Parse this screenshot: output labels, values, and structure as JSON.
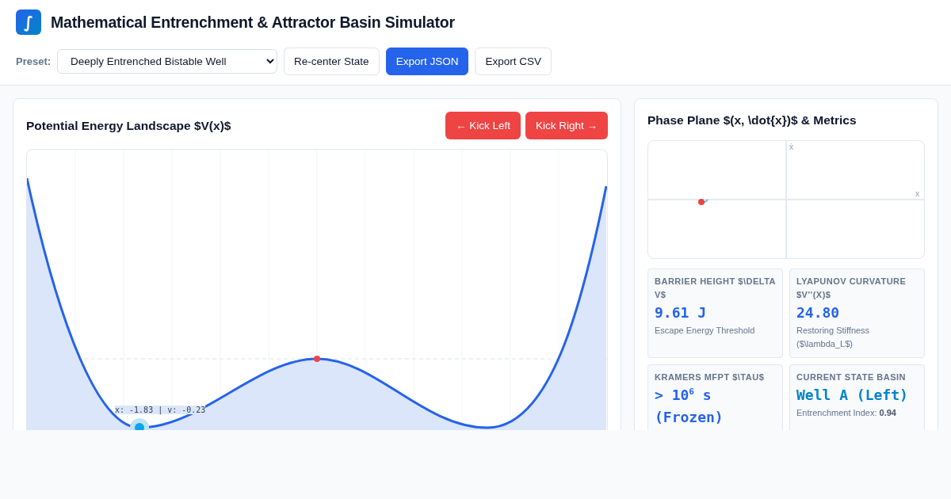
{
  "header": {
    "logo": "∫",
    "title": "Mathematical Entrenchment & Attractor Basin Simulator"
  },
  "toolbar": {
    "preset_label": "Preset:",
    "preset_value": "Deeply Entrenched Bistable Well",
    "buttons": [
      {
        "label": "Re-center State",
        "kind": "plain"
      },
      {
        "label": "Export JSON",
        "kind": "primary"
      },
      {
        "label": "Export CSV",
        "kind": "plain"
      }
    ]
  },
  "potential_panel": {
    "title": "Potential Energy Landscape $V(x)$",
    "buttons": [
      {
        "label": "Kick Left",
        "arrow": "←",
        "kind": "left"
      },
      {
        "label": "Kick Right",
        "arrow": "→",
        "kind": "right"
      }
    ],
    "readout": "x: -1.83 | v: -0.23"
  },
  "phase_panel": {
    "title": "Phase Plane $(x, \\dot{x})$ & Metrics",
    "y_axis_label": "ẋ",
    "x_axis_label": "x",
    "metrics": [
      {
        "label": "BARRIER HEIGHT $\\DELTA V$",
        "value": "9.61 J",
        "color": "#2563eb",
        "caption": "Escape Energy Threshold"
      },
      {
        "label": "LYAPUNOV CURVATURE $V''(X)$",
        "value": "24.80",
        "color": "#2563eb",
        "caption": "Restoring Stiffness ($\\lambda_L$)"
      },
      {
        "label": "KRAMERS MFPT $\\TAU$",
        "value": "> 10$^{6}$ s (Frozen)",
        "color": "#2563eb"
      },
      {
        "label": "CURRENT STATE BASIN",
        "value": "Well A (Left)",
        "color": "#0284c7",
        "caption": "Entrenchment Index: **0.94**"
      }
    ]
  }
}
